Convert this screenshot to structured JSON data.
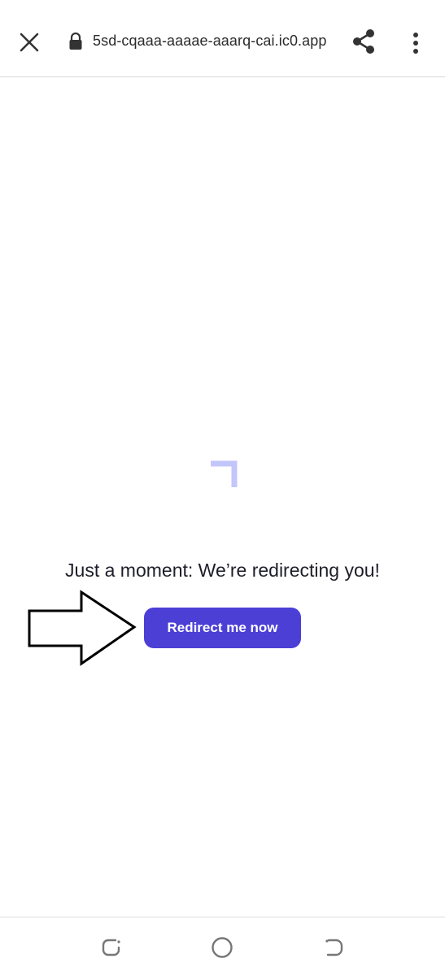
{
  "browser": {
    "url": "5sd-cqaaa-aaaae-aaarq-cai.ic0.app",
    "icons": {
      "close": "close-icon",
      "lock": "lock-icon",
      "share": "share-icon",
      "menu": "more-vert-icon"
    }
  },
  "main": {
    "message": "Just a moment: We’re redirecting you!",
    "redirect_button": "Redirect me now",
    "spinner_icon": "loading-spinner-icon",
    "pointer_icon": "arrow-right-outline-icon"
  },
  "system_nav": {
    "icons": [
      "recent-apps-icon",
      "home-icon",
      "back-icon"
    ]
  },
  "colors": {
    "button": "#4b3fd6",
    "spinner": "#c3c6fb",
    "text": "#1e1e2a"
  }
}
